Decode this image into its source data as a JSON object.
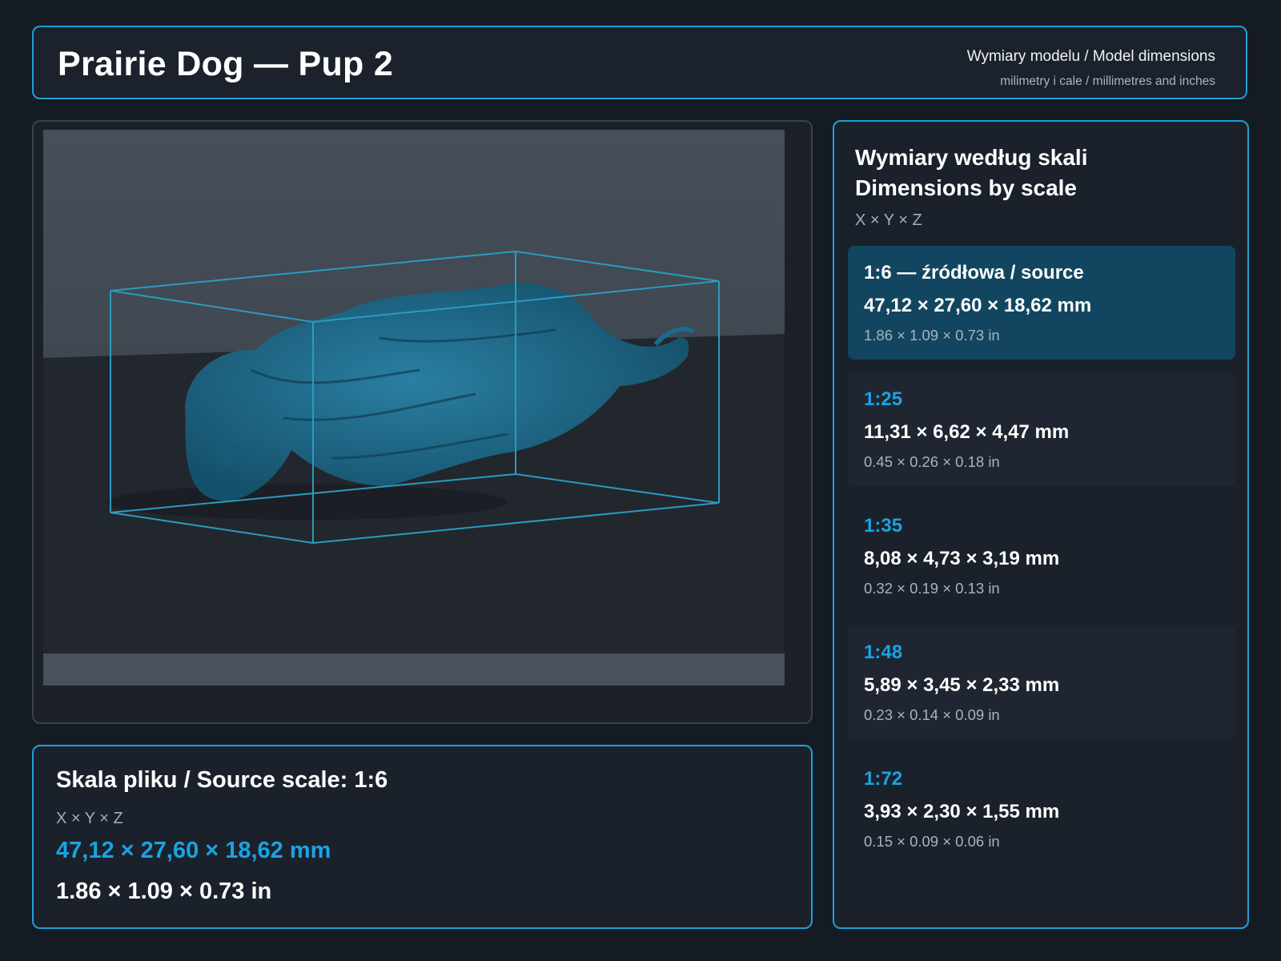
{
  "header": {
    "title": "Prairie Dog — Pup 2",
    "subtitle": "Wymiary modelu / Model dimensions",
    "units_note": "milimetry i cale / millimetres and inches"
  },
  "viewer": {
    "model_color": "#1f6f8f",
    "bbox_color": "#2a9bc0"
  },
  "source": {
    "title": "Skala pliku / Source scale: 1:6",
    "axes": "X × Y × Z",
    "mm": "47,12 × 27,60 × 18,62 mm",
    "inches": "1.86 × 1.09 × 0.73 in"
  },
  "scales": {
    "title_line1": "Wymiary według skali",
    "title_line2": "Dimensions by scale",
    "axes": "X × Y × Z",
    "items": [
      {
        "label": "1:6  —  źródłowa / source",
        "mm": "47,12 × 27,60 × 18,62 mm",
        "inches": "1.86 × 1.09 × 0.73 in"
      },
      {
        "label": "1:25",
        "mm": "11,31 × 6,62 × 4,47 mm",
        "inches": "0.45 × 0.26 × 0.18 in"
      },
      {
        "label": "1:35",
        "mm": "8,08 × 4,73 × 3,19 mm",
        "inches": "0.32 × 0.19 × 0.13 in"
      },
      {
        "label": "1:48",
        "mm": "5,89 × 3,45 × 2,33 mm",
        "inches": "0.23 × 0.14 × 0.09 in"
      },
      {
        "label": "1:72",
        "mm": "3,93 × 2,30 × 1,55 mm",
        "inches": "0.15 × 0.09 × 0.06 in"
      }
    ]
  },
  "colors": {
    "accent": "#1aa3e2",
    "active_card": "#124660",
    "background": "#151b23"
  }
}
